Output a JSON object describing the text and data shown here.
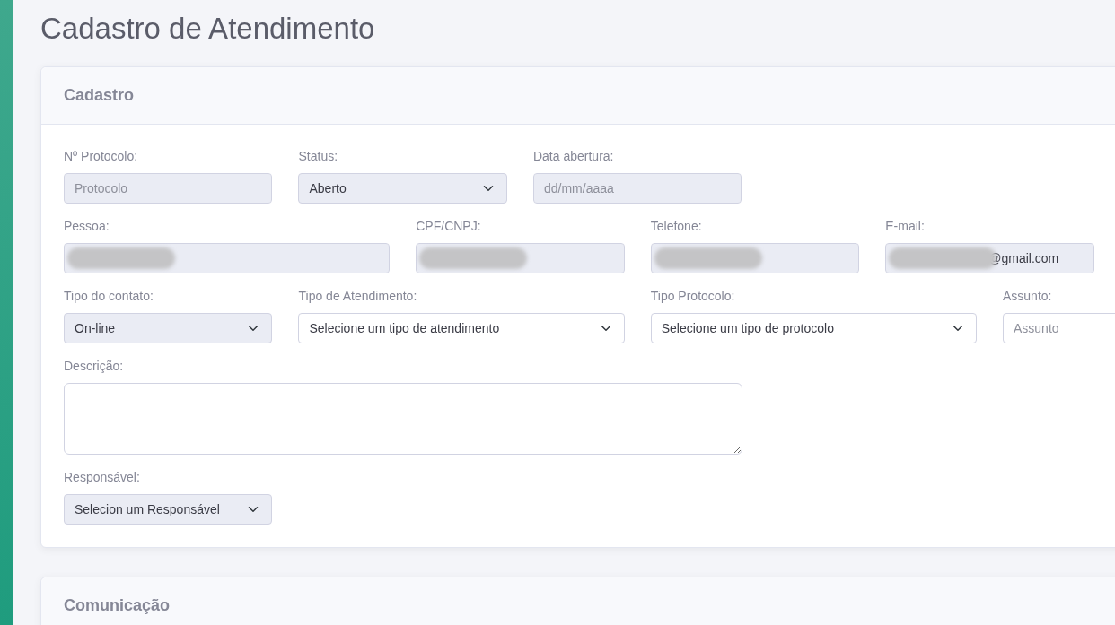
{
  "page_title": "Cadastro de Atendimento",
  "cards": [
    {
      "title": "Cadastro",
      "rows": [
        [
          {
            "label": "Nº Protocolo:",
            "kind": "input",
            "placeholder": "Protocolo",
            "disabled": true
          },
          {
            "label": "Status:",
            "kind": "select",
            "value": "Aberto",
            "disabled": true
          },
          {
            "label": "Data abertura:",
            "kind": "input",
            "placeholder": "dd/mm/aaaa",
            "disabled": true
          }
        ],
        [
          {
            "label": "Pessoa:",
            "kind": "input",
            "disabled": true,
            "redacted": true
          },
          {
            "label": "CPF/CNPJ:",
            "kind": "input",
            "disabled": true,
            "redacted": true
          },
          {
            "label": "Telefone:",
            "kind": "input",
            "disabled": true,
            "redacted": true
          },
          {
            "label": "E-mail:",
            "kind": "input",
            "value": "@gmail.com",
            "disabled": true,
            "redacted": true
          }
        ],
        [
          {
            "label": "Tipo do contato:",
            "kind": "select",
            "value": "On-line",
            "disabled": true
          },
          {
            "label": "Tipo de Atendimento:",
            "kind": "select",
            "value": "Selecione um tipo de atendimento",
            "disabled": false
          },
          {
            "label": "Tipo Protocolo:",
            "kind": "select",
            "value": "Selecione um tipo de protocolo",
            "disabled": false
          },
          {
            "label": "Assunto:",
            "kind": "input",
            "placeholder": "Assunto",
            "disabled": false
          }
        ],
        [
          {
            "label": "Descrição:",
            "kind": "textarea",
            "disabled": false
          }
        ],
        [
          {
            "label": "Responsável:",
            "kind": "select",
            "value": "Selecion um Responsável",
            "disabled": true
          }
        ]
      ]
    },
    {
      "title": "Comunicação"
    }
  ]
}
